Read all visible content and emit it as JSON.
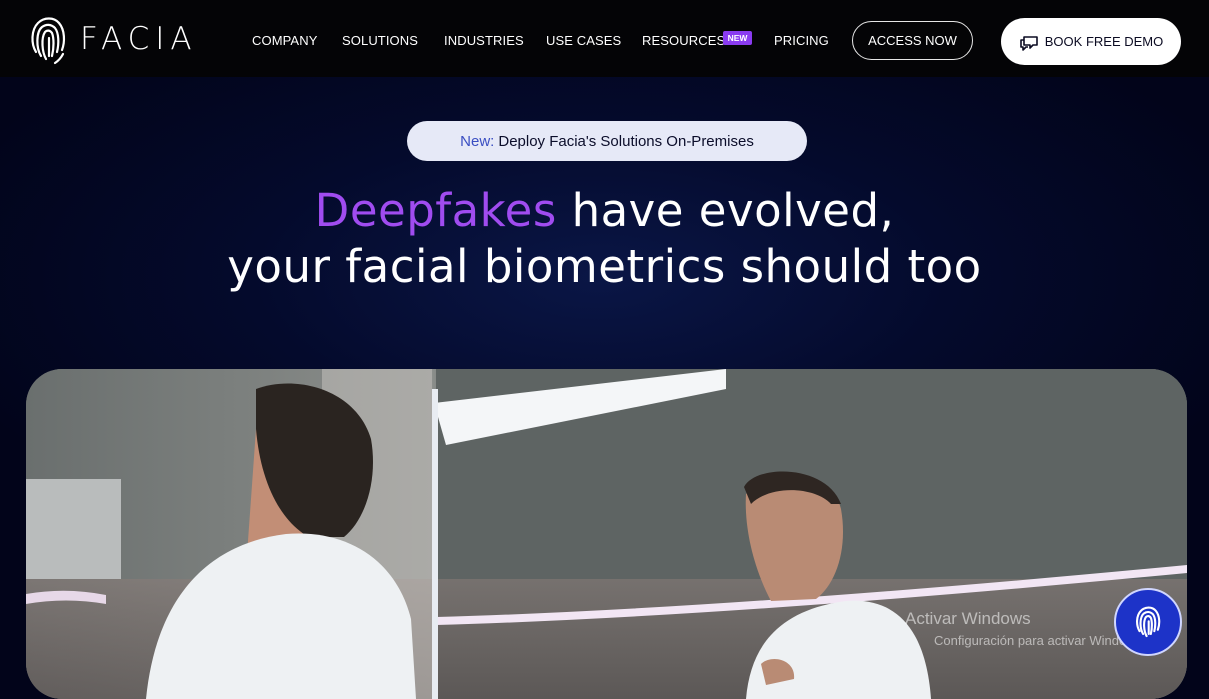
{
  "nav": {
    "logo_text": "FACIA",
    "items": [
      {
        "label": "COMPANY"
      },
      {
        "label": "SOLUTIONS"
      },
      {
        "label": "INDUSTRIES"
      },
      {
        "label": "USE CASES"
      },
      {
        "label": "RESOURCES"
      },
      {
        "label": "PRICING"
      }
    ],
    "resources_badge": "NEW",
    "access_label": "ACCESS NOW",
    "demo_label": "BOOK FREE DEMO",
    "demo_icon": "chat-bubbles-icon"
  },
  "announcement": {
    "highlight": "New:",
    "text": "Deploy Facia's Solutions On-Premises"
  },
  "hero": {
    "line1_highlight": "Deepfakes",
    "line1_rest": " have evolved,",
    "line2": "your facial biometrics should too",
    "highlight_color": "#a04cf0"
  },
  "watermark": {
    "line1": "Activar Windows",
    "line2": "Configuración para activar Windows."
  },
  "chat_widget": {
    "icon": "facia-fingerprint-icon"
  }
}
